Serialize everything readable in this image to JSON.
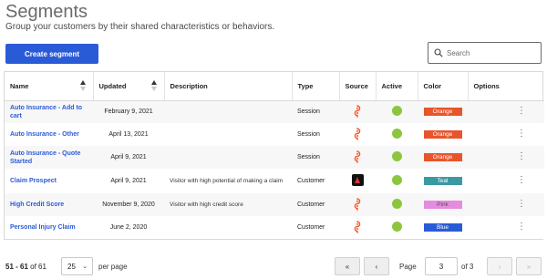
{
  "header": {
    "title": "Segments",
    "subtitle": "Group your customers by their shared characteristics or behaviors."
  },
  "toolbar": {
    "create_label": "Create segment",
    "search_placeholder": "Search"
  },
  "table": {
    "columns": {
      "name": "Name",
      "updated": "Updated",
      "description": "Description",
      "type": "Type",
      "source": "Source",
      "active": "Active",
      "color": "Color",
      "options": "Options"
    },
    "rows": [
      {
        "name": "Auto Insurance - Add to cart",
        "updated": "February 9, 2021",
        "description": "",
        "type": "Session",
        "source": "journey-icon",
        "active": true,
        "color_label": "Orange",
        "color_hex": "#e8542b",
        "color_text": "#ffffff"
      },
      {
        "name": "Auto Insurance - Other",
        "updated": "April 13, 2021",
        "description": "",
        "type": "Session",
        "source": "journey-icon",
        "active": true,
        "color_label": "Orange",
        "color_hex": "#e8542b",
        "color_text": "#ffffff"
      },
      {
        "name": "Auto Insurance - Quote Started",
        "updated": "April 9, 2021",
        "description": "",
        "type": "Session",
        "source": "journey-icon",
        "active": true,
        "color_label": "Orange",
        "color_hex": "#e8542b",
        "color_text": "#ffffff"
      },
      {
        "name": "Claim Prospect",
        "updated": "April 9, 2021",
        "description": "Visitor with high potential of making a claim",
        "type": "Customer",
        "source": "adobe-icon",
        "active": true,
        "color_label": "Teal",
        "color_hex": "#3a9aa3",
        "color_text": "#ffffff"
      },
      {
        "name": "High Credit Score",
        "updated": "November 9, 2020",
        "description": "Visitor with high credit score",
        "type": "Customer",
        "source": "journey-icon",
        "active": true,
        "color_label": "Pink",
        "color_hex": "#e58be0",
        "color_text": "#555555"
      },
      {
        "name": "Personal Injury Claim",
        "updated": "June 2, 2020",
        "description": "",
        "type": "Customer",
        "source": "journey-icon",
        "active": true,
        "color_label": "Blue",
        "color_hex": "#2a5bd7",
        "color_text": "#ffffff"
      }
    ]
  },
  "pagination": {
    "range": "51 - 61",
    "of_total": "of 61",
    "per_page_value": "25",
    "per_page_label": "per page",
    "page_label": "Page",
    "current_page": "3",
    "of_pages": "of 3",
    "first_label": "«",
    "prev_label": "‹",
    "next_label": "›",
    "last_label": "»"
  },
  "colors": {
    "accent": "#2a5bd7",
    "active": "#8cc63f",
    "source_icon": "#ff4f1f"
  }
}
